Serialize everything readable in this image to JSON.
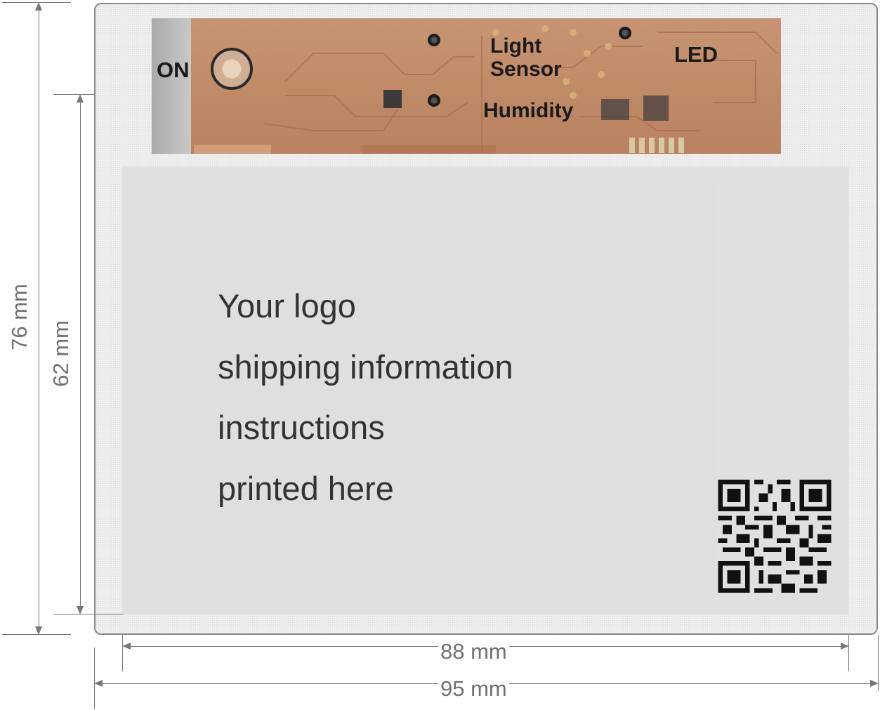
{
  "pcb": {
    "on_label": "ON",
    "light_label_line1": "Light",
    "light_label_line2": "Sensor",
    "humidity_label": "Humidity",
    "led_label": "LED"
  },
  "label_area": {
    "lines": [
      "Your logo",
      "shipping information",
      "instructions",
      "printed here"
    ]
  },
  "dimensions": {
    "outer_height": "76 mm",
    "inner_height": "62 mm",
    "inner_width": "88 mm",
    "outer_width": "95 mm"
  }
}
